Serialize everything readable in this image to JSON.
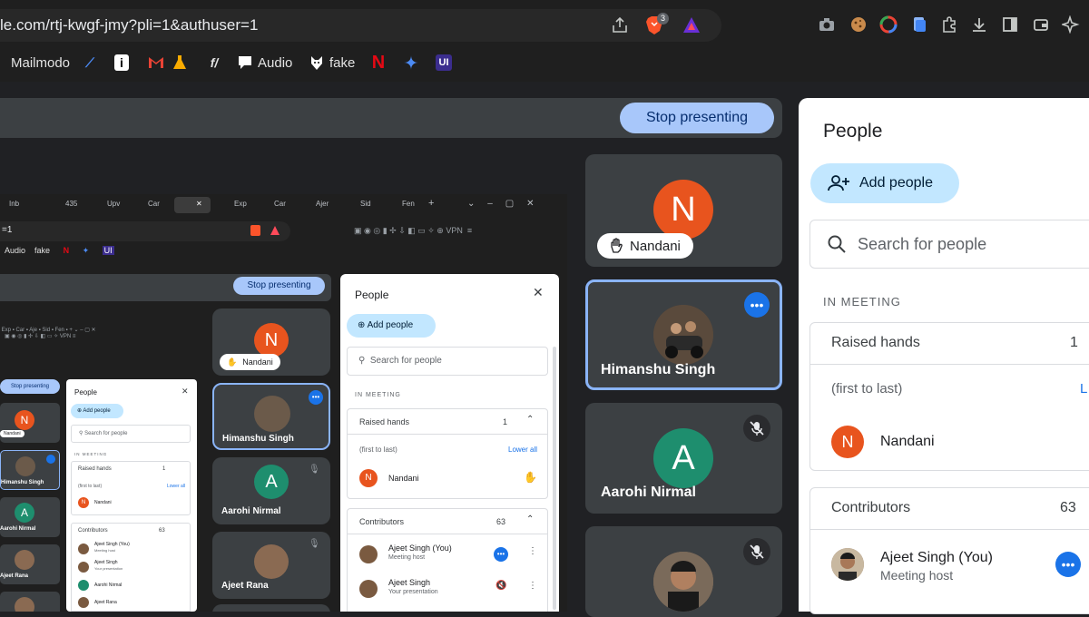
{
  "browser": {
    "url": "le.com/rtj-kwgf-jmy?pli=1&authuser=1",
    "brave_badge": "3",
    "bookmarks": [
      {
        "label": "Mailmodo"
      },
      {
        "label": ""
      },
      {
        "label": ""
      },
      {
        "label": ""
      },
      {
        "label": ""
      },
      {
        "label": ""
      },
      {
        "label": "Audio"
      },
      {
        "label": "fake"
      },
      {
        "label": ""
      },
      {
        "label": ""
      },
      {
        "label": ""
      }
    ]
  },
  "meet": {
    "stop_presenting": "Stop presenting",
    "tiles": [
      {
        "name": "Nandani",
        "initial": "N",
        "color": "#e8541e",
        "hand_raised": true
      },
      {
        "name": "Himanshu Singh",
        "pinned": true
      },
      {
        "name": "Aarohi Nirmal",
        "initial": "A",
        "color": "#1e8e6e",
        "muted": true
      },
      {
        "name": "",
        "muted": true
      }
    ]
  },
  "presentation": {
    "tabs": [
      "Inb",
      "435",
      "Upv",
      "Car",
      "",
      "Exp",
      "Car",
      "Ajer",
      "Sid",
      "Fen"
    ],
    "url": "=1",
    "badge": "3",
    "bookmarks": [
      "Audio",
      "fake"
    ],
    "vpn": "VPN",
    "stop_presenting": "Stop presenting",
    "people_title": "People",
    "add_people": "Add people",
    "search_placeholder": "Search for people",
    "in_meeting": "IN MEETING",
    "raised_hands": "Raised hands",
    "raised_count": "1",
    "first_to_last": "(first to last)",
    "lower_all": "Lower all",
    "nandani": "Nandani",
    "contributors": "Contributors",
    "contributors_count": "63",
    "p1_name": "Ajeet Singh (You)",
    "p1_sub": "Meeting host",
    "p2_name": "Ajeet Singh",
    "p2_sub": "Your presentation",
    "tile_nandani": "Nandani",
    "tile_himanshu": "Himanshu Singh",
    "tile_aarohi": "Aarohi Nirmal",
    "tile_ajeet": "Ajeet Rana",
    "inner2": {
      "people_title": "People",
      "add_people": "Add people",
      "search": "Search for people",
      "in_meeting": "IN MEETING",
      "raised": "Raised hands",
      "raised_count": "1",
      "first": "(first to last)",
      "lower_all": "Lower all",
      "nandani": "Nandani",
      "contributors": "Contributors",
      "count": "63",
      "p1": "Ajeet Singh (You)",
      "p1_sub": "Meeting host",
      "p2": "Ajeet Singh",
      "p2_sub": "Your presentation",
      "p3": "Aarohi Nirmal",
      "p4": "Ajeet Rana",
      "tile_n": "Nandani",
      "tile_h": "Himanshu Singh",
      "tile_a": "Aarohi Nirmal",
      "tile_r": "Ajeet Rana",
      "stop": "Stop presenting"
    }
  },
  "people_panel": {
    "title": "People",
    "add_people": "Add people",
    "search_placeholder": "Search for people",
    "in_meeting": "IN MEETING",
    "raised_hands": {
      "title": "Raised hands",
      "count": "1",
      "order": "(first to last)",
      "lower_all": "L",
      "people": [
        {
          "name": "Nandani",
          "initial": "N"
        }
      ]
    },
    "contributors": {
      "title": "Contributors",
      "count": "63",
      "people": [
        {
          "name": "Ajeet Singh (You)",
          "role": "Meeting host"
        }
      ]
    }
  },
  "colors": {
    "accent": "#a8c7fa",
    "panel_chip": "#c2e7ff",
    "blue_dot": "#1a73e8",
    "orange": "#e8541e",
    "teal": "#1e8e6e"
  }
}
